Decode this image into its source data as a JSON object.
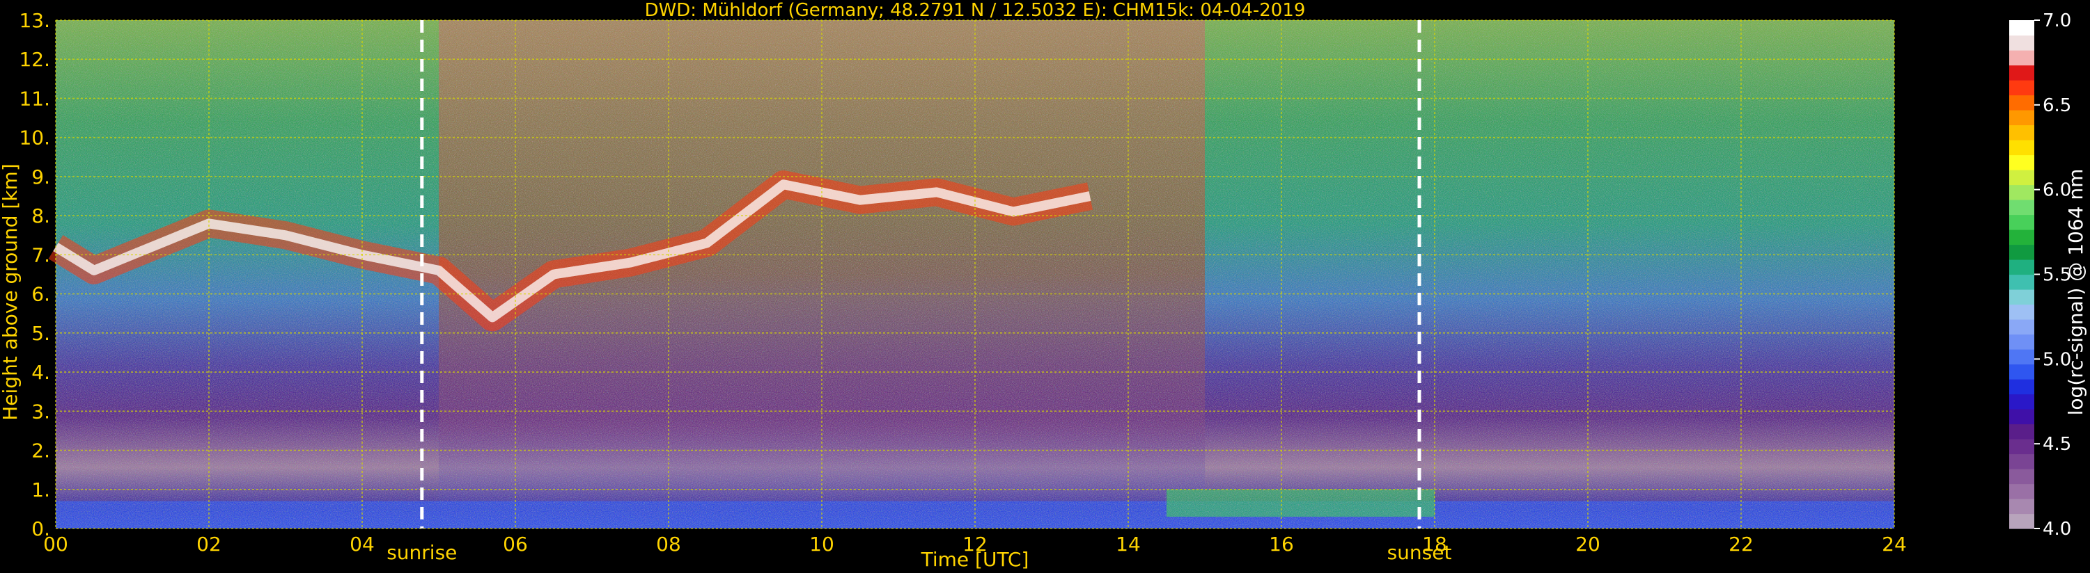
{
  "chart_data": {
    "type": "heatmap",
    "title": "DWD: Mühldorf (Germany; 48.2791 N / 12.5032 E):    CHM15k: 04-04-2019",
    "xlabel": "Time [UTC]",
    "ylabel": "Height above ground [km]",
    "xlim": [
      0,
      24
    ],
    "ylim": [
      0,
      13
    ],
    "x_ticks": [
      "00",
      "02",
      "04",
      "06",
      "08",
      "10",
      "12",
      "14",
      "16",
      "18",
      "20",
      "22",
      "24"
    ],
    "y_ticks": [
      "0.",
      "1.",
      "2.",
      "3.",
      "4.",
      "5.",
      "6.",
      "7.",
      "8.",
      "9.",
      "10.",
      "11.",
      "12.",
      "13."
    ],
    "grid": true,
    "markers": [
      {
        "label": "sunrise",
        "x": 4.78
      },
      {
        "label": "sunset",
        "x": 17.8
      }
    ],
    "colorbar": {
      "label": "log(rc-signal) @ 1064 nm",
      "range": [
        4.0,
        7.0
      ],
      "ticks": [
        "4.0",
        "4.5",
        "5.0",
        "5.5",
        "6.0",
        "6.5",
        "7.0"
      ],
      "colors": [
        "#b8a4bc",
        "#a888b0",
        "#9a70a6",
        "#8a5a9c",
        "#7a4494",
        "#6a2e8e",
        "#5a1e8a",
        "#3f10a8",
        "#2a18c8",
        "#1f2fe0",
        "#2f56f0",
        "#4f76f4",
        "#6f90f6",
        "#8aa8f6",
        "#9ec0f4",
        "#7fd0d8",
        "#3fc0b0",
        "#1fb080",
        "#109a40",
        "#23b23a",
        "#48d05a",
        "#70dd70",
        "#a0e860",
        "#d0f040",
        "#ffff20",
        "#ffe000",
        "#ffc000",
        "#ff9800",
        "#ff6c00",
        "#ff3a10",
        "#e01818",
        "#f4b0b0",
        "#f0e0e0",
        "#ffffff"
      ]
    }
  }
}
